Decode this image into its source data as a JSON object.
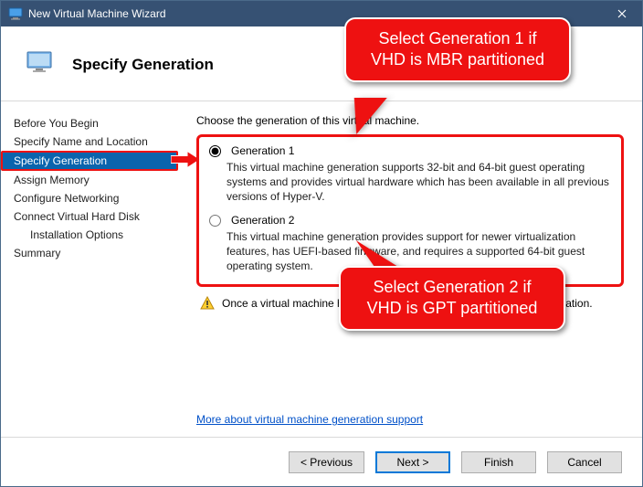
{
  "window": {
    "title": "New Virtual Machine Wizard"
  },
  "header": {
    "pageTitle": "Specify Generation"
  },
  "sidebar": {
    "steps": [
      "Before You Begin",
      "Specify Name and Location",
      "Specify Generation",
      "Assign Memory",
      "Configure Networking",
      "Connect Virtual Hard Disk",
      "Installation Options",
      "Summary"
    ],
    "activeIndex": 2,
    "indentIndex": 6
  },
  "main": {
    "instruction": "Choose the generation of this virtual machine.",
    "options": [
      {
        "label": "Generation 1",
        "selected": true,
        "desc": "This virtual machine generation supports 32-bit and 64-bit guest operating systems and provides virtual hardware which has been available in all previous versions of Hyper-V."
      },
      {
        "label": "Generation 2",
        "selected": false,
        "desc": "This virtual machine generation provides support for newer virtualization features, has UEFI-based firmware, and requires a supported 64-bit guest operating system."
      }
    ],
    "warning": "Once a virtual machine has been created, you cannot change its generation.",
    "moreLink": "More about virtual machine generation support"
  },
  "buttons": {
    "previous": "< Previous",
    "next": "Next >",
    "finish": "Finish",
    "cancel": "Cancel"
  },
  "callouts": {
    "c1": "Select Generation 1 if VHD is MBR partitioned",
    "c2": "Select Generation 2 if VHD is GPT partitioned"
  },
  "colors": {
    "accent": "#0078d7",
    "annotation": "#e11",
    "titlebar": "#365173"
  }
}
